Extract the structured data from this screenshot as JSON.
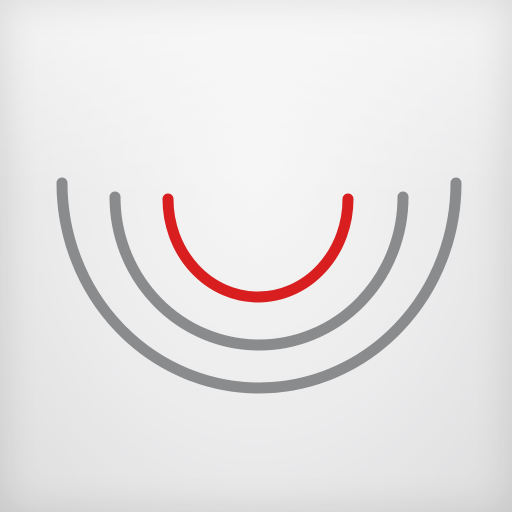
{
  "icon": {
    "name": "signal-arcs-icon",
    "colors": {
      "background": "#ececec",
      "outer_arcs": "#8a8b8d",
      "inner_arc": "#d81e1e"
    }
  }
}
